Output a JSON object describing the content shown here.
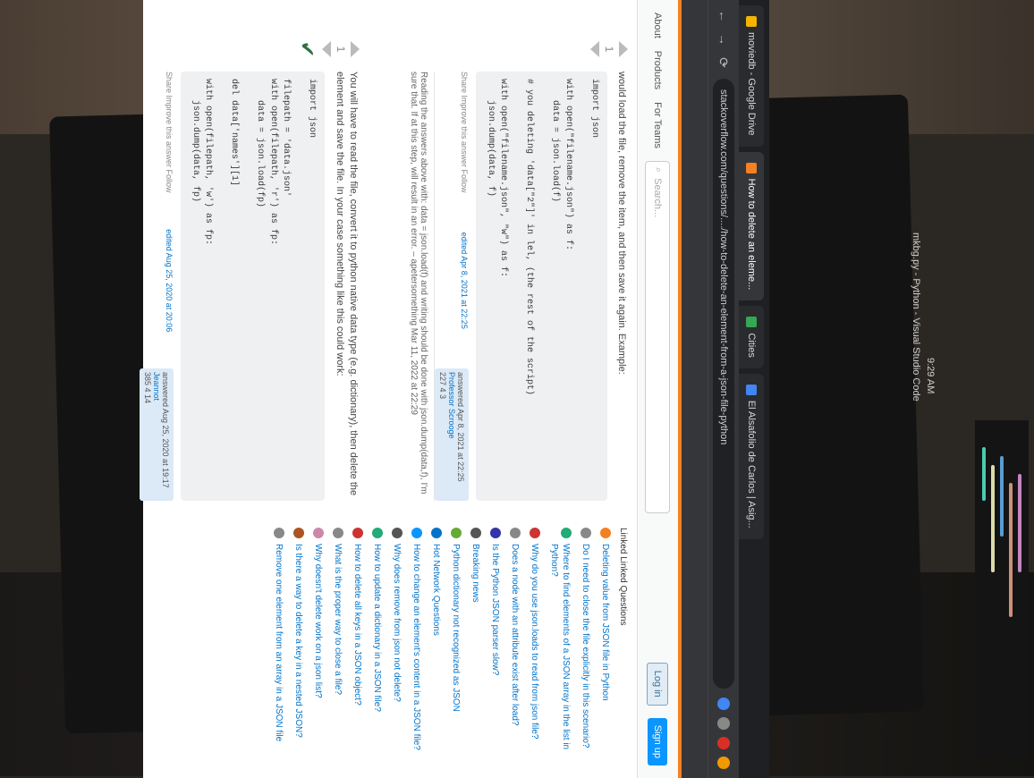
{
  "browser": {
    "tabs": [
      {
        "title": "moviedb - Google Drive",
        "color": "#f4b400"
      },
      {
        "title": "How to delete an eleme...",
        "color": "#f48024",
        "active": true
      },
      {
        "title": "Cities",
        "color": "#34a853"
      },
      {
        "title": "El Alsafolio de Carlos | Asig...",
        "color": "#4285f4"
      }
    ],
    "url": "stackoverflow.com/questions/..../how-to-delete-an-element-from-a-json-file-python",
    "nav": {
      "back": "←",
      "forward": "→",
      "reload": "⟳"
    }
  },
  "so": {
    "nav": {
      "about": "About",
      "products": "Products",
      "for_teams": "For Teams"
    },
    "search_placeholder": "Search...",
    "login": "Log in",
    "signup": "Sign up"
  },
  "answer1": {
    "votes": "1",
    "text": "would load the file, remove the item, and then save it again. Example:",
    "code": "import json\n\nwith open(\"filename.json\") as f:\n    data = json.load(f)\n\n# you deleting 'data[\"2\"]' in lel, (the rest of the script)\n\nwith open(\"filename.json\", \"w\") as f:\n    json.dump(data, f)",
    "share": "Share  Improve this answer  Follow",
    "edited": "edited Apr 8, 2021 at 22:25",
    "answered": "answered Apr 8, 2021 at 22:25",
    "user": "Professor Scrooge",
    "rep": "227  4  3",
    "comment": "Reading the answers above with: data = json.load(f) and writing should be done with json.dump(data,f), I'm sure that. If at this step, will result in an error. – apetersomething  Mar 11, 2022 at 22:29"
  },
  "answer2": {
    "votes": "1",
    "text": "You will have to read the file, convert it to python native data type (e.g. dictionary), then delete the element and save the file. In your case something like this could work:",
    "code": "import json\n\nfilepath = 'data.json'\nwith open(filepath, 'r') as fp:\n    data = json.load(fp)\n\ndel data['names'][1]\n\nwith open(filepath, 'w') as fp:\n    json.dump(data, fp)",
    "share": "Share  Improve this answer  Follow",
    "edited": "edited Aug 25, 2020 at 20:06",
    "answered": "answered Aug 25, 2020 at 19:17",
    "user": "Jeannot",
    "rep": "385  4  14"
  },
  "sidebar": {
    "heading": "Linked  Linked Questions",
    "items": [
      {
        "text": "Deleting value from JSON file in Python",
        "color": "#f48024"
      },
      {
        "text": "Do I need to close the file explicitly in this scenario?",
        "color": "#888"
      },
      {
        "text": "Where to find elements of a JSON array in the list in Python?",
        "color": "#2a7"
      },
      {
        "text": "Why do you use json.loads to read from json file?",
        "color": "#c33"
      },
      {
        "text": "Does a node with an attribute exist after load?",
        "color": "#888"
      },
      {
        "text": "Is the Python JSON parser slow?",
        "color": "#33a"
      },
      {
        "text": "Breaking news",
        "color": "#555"
      },
      {
        "text": "Python dictionary not recognized as JSON",
        "color": "#6a3"
      },
      {
        "text": "Hot Network Questions",
        "color": "#0074cc"
      },
      {
        "text": "How to change an element's content in a JSON file?",
        "color": "#0a95ff"
      },
      {
        "text": "Why does remove from json not delete?",
        "color": "#555"
      },
      {
        "text": "How to update a dictionary in a JSON file?",
        "color": "#2a7"
      },
      {
        "text": "How to delete all keys in a JSON object?",
        "color": "#c33"
      },
      {
        "text": "What is the proper way to close a file?",
        "color": "#888"
      },
      {
        "text": "Why doesn't delete work on a json list?",
        "color": "#c8a"
      },
      {
        "text": "Is there a way to delete a key in a nested JSON?",
        "color": "#a52"
      },
      {
        "text": "Remove one element from an array in a JSON file",
        "color": "#888"
      }
    ]
  },
  "taskbar": {
    "title": "mkbg.py - Python - Visual Studio Code",
    "clock": "9:29 AM"
  }
}
